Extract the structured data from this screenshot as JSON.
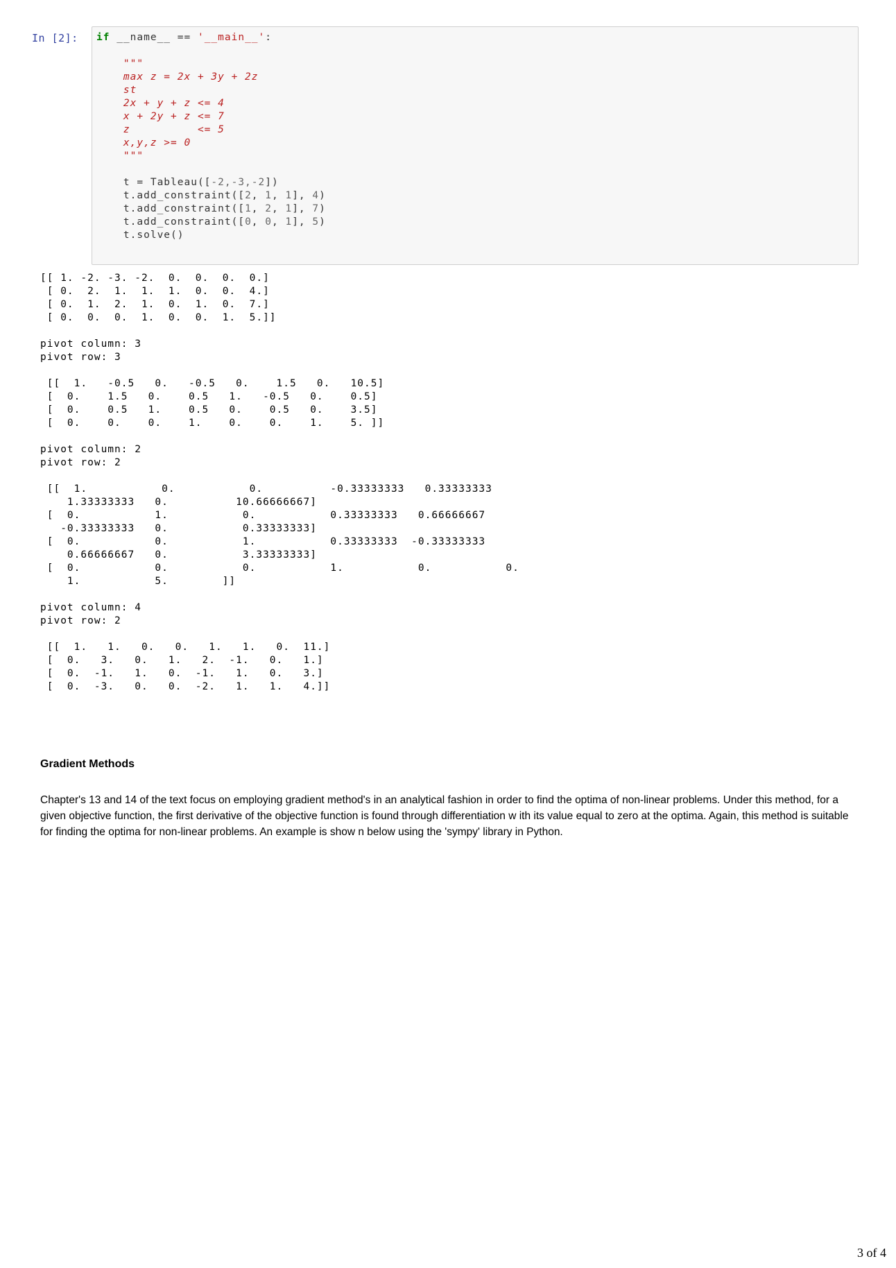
{
  "cell": {
    "prompt": "In [2]:",
    "code": {
      "if_kw": "if",
      "line1_mid": " __name__ == ",
      "main_str": "'__main__'",
      "line1_end": ":",
      "doc_open": "    \"\"\"",
      "doc_lines": [
        "    max z = 2x + 3y + 2z",
        "    st",
        "    2x + y + z <= 4",
        "    x + 2y + z <= 7",
        "    z          <= 5",
        "    x,y,z >= 0",
        "    \"\"\""
      ],
      "tableau_call": "    t = Tableau([",
      "tableau_args": "-2,-3,-2",
      "tableau_close": "])",
      "constraints": [
        {
          "prefix": "    t.add_constraint([",
          "a": "2",
          "b": "1",
          "c": "1",
          "rhs": "4"
        },
        {
          "prefix": "    t.add_constraint([",
          "a": "1",
          "b": "2",
          "c": "1",
          "rhs": "7"
        },
        {
          "prefix": "    t.add_constraint([",
          "a": "0",
          "b": "0",
          "c": "1",
          "rhs": "5"
        }
      ],
      "solve": "    t.solve()"
    }
  },
  "output": {
    "text": "[[ 1. -2. -3. -2.  0.  0.  0.  0.]\n [ 0.  2.  1.  1.  1.  0.  0.  4.]\n [ 0.  1.  2.  1.  0.  1.  0.  7.]\n [ 0.  0.  0.  1.  0.  0.  1.  5.]]\n\npivot column: 3\npivot row: 3\n\n [[  1.   -0.5   0.   -0.5   0.    1.5   0.   10.5]\n [  0.    1.5   0.    0.5   1.   -0.5   0.    0.5]\n [  0.    0.5   1.    0.5   0.    0.5   0.    3.5]\n [  0.    0.    0.    1.    0.    0.    1.    5. ]]\n\npivot column: 2\npivot row: 2\n\n [[  1.           0.           0.          -0.33333333   0.33333333\n    1.33333333   0.          10.66666667]\n [  0.           1.           0.           0.33333333   0.66666667\n   -0.33333333   0.           0.33333333]\n [  0.           0.           1.           0.33333333  -0.33333333\n    0.66666667   0.           3.33333333]\n [  0.           0.           0.           1.           0.           0.\n    1.           5.        ]]\n\npivot column: 4\npivot row: 2\n\n [[  1.   1.   0.   0.   1.   1.   0.  11.]\n [  0.   3.   0.   1.   2.  -1.   0.   1.]\n [  0.  -1.   1.   0.  -1.   1.   0.   3.]\n [  0.  -3.   0.   0.  -2.   1.   1.   4.]]"
  },
  "section": {
    "heading": "Gradient Methods",
    "paragraph": "Chapter's 13 and 14 of the text focus on employing gradient method's in an analytical fashion in order to find the optima of non-linear problems. Under this method, for a given objective function, the first derivative of the objective function is found through differentiation w ith its value equal to zero at the optima. Again, this method is suitable for finding the optima for non-linear problems. An example is show n below  using the 'sympy' library in Python."
  },
  "footer": {
    "page": "3 of 4"
  }
}
